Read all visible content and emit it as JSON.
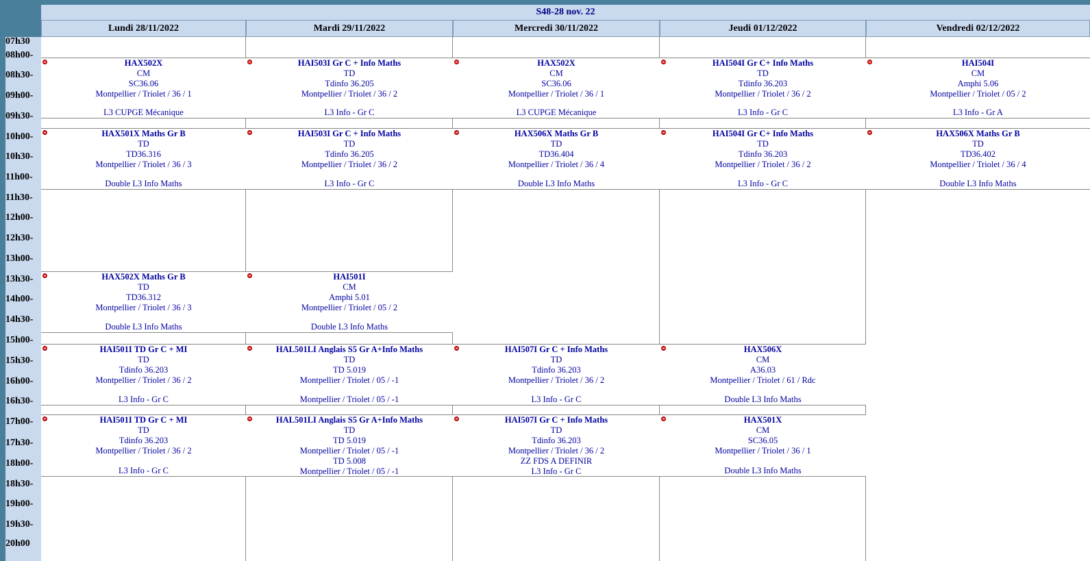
{
  "week_label": "S48-28 nov. 22",
  "days": [
    "Lundi 28/11/2022",
    "Mardi 29/11/2022",
    "Mercredi 30/11/2022",
    "Jeudi 01/12/2022",
    "Vendredi 02/12/2022"
  ],
  "times": [
    "07h30",
    "08h00-",
    "08h30-",
    "09h00-",
    "09h30-",
    "10h00-",
    "10h30-",
    "11h00-",
    "11h30-",
    "12h00-",
    "12h30-",
    "13h00-",
    "13h30-",
    "14h00-",
    "14h30-",
    "15h00-",
    "15h30-",
    "16h00-",
    "16h30-",
    "17h00-",
    "17h30-",
    "18h00-",
    "18h30-",
    "19h00-",
    "19h30-",
    "20h00"
  ],
  "events": {
    "mon_1": {
      "title": "HAX502X",
      "type": "CM",
      "room": "SC36.06",
      "place": "Montpellier / Triolet / 36 / 1",
      "group": "L3 CUPGE Mécanique"
    },
    "mon_2": {
      "title": "HAX501X Maths Gr B",
      "type": "TD",
      "room": "TD36.316",
      "place": "Montpellier / Triolet / 36 / 3",
      "group": "Double L3 Info Maths"
    },
    "mon_3": {
      "title": "HAX502X Maths Gr B",
      "type": "TD",
      "room": "TD36.312",
      "place": "Montpellier / Triolet / 36 / 3",
      "group": "Double L3 Info Maths"
    },
    "mon_4": {
      "title": "HAI501I TD Gr C + MI",
      "type": "TD",
      "room": "Tdinfo 36.203",
      "place": "Montpellier / Triolet / 36 / 2",
      "group": "L3 Info - Gr C"
    },
    "mon_5": {
      "title": "HAI501I TD Gr C + MI",
      "type": "TD",
      "room": "Tdinfo 36.203",
      "place": "Montpellier / Triolet / 36 / 2",
      "group": "L3 Info - Gr C"
    },
    "tue_1": {
      "title": "HAI503I Gr C + Info Maths",
      "type": "TD",
      "room": "Tdinfo 36.205",
      "place": "Montpellier / Triolet / 36 / 2",
      "group": "L3 Info - Gr C"
    },
    "tue_2": {
      "title": "HAI503I Gr C + Info Maths",
      "type": "TD",
      "room": "Tdinfo 36.205",
      "place": "Montpellier / Triolet / 36 / 2",
      "group": "L3 Info - Gr C"
    },
    "tue_3": {
      "title": "HAI501I",
      "type": "CM",
      "room": "Amphi 5.01",
      "place": "Montpellier / Triolet / 05 / 2",
      "group": "Double L3 Info Maths"
    },
    "tue_4": {
      "title": "HAL501LI Anglais S5 Gr A+Info Maths",
      "type": "TD",
      "room": "TD 5.019",
      "place": "Montpellier / Triolet / 05 / -1",
      "group": "Montpellier / Triolet / 05 / -1"
    },
    "tue_5": {
      "title": "HAL501LI Anglais S5 Gr A+Info Maths",
      "type": "TD",
      "room": "TD 5.019",
      "place": "Montpellier / Triolet / 05 / -1",
      "room2": "TD 5.008",
      "group": "Montpellier / Triolet / 05 / -1"
    },
    "wed_1": {
      "title": "HAX502X",
      "type": "CM",
      "room": "SC36.06",
      "place": "Montpellier / Triolet / 36 / 1",
      "group": "L3 CUPGE Mécanique"
    },
    "wed_2": {
      "title": "HAX506X Maths Gr B",
      "type": "TD",
      "room": "TD36.404",
      "place": "Montpellier / Triolet / 36 / 4",
      "group": "Double L3 Info Maths"
    },
    "wed_3": {
      "title": "HAI507I Gr C + Info Maths",
      "type": "TD",
      "room": "Tdinfo 36.203",
      "place": "Montpellier / Triolet / 36 / 2",
      "group": "L3 Info - Gr C"
    },
    "wed_4": {
      "title": "HAI507I Gr C + Info Maths",
      "type": "TD",
      "room": "Tdinfo 36.203",
      "place": "Montpellier / Triolet / 36 / 2",
      "extra": "ZZ FDS   A DEFINIR",
      "group": "L3 Info - Gr C"
    },
    "thu_1": {
      "title": "HAI504I Gr C+ Info Maths",
      "type": "TD",
      "room": "Tdinfo 36.203",
      "place": "Montpellier / Triolet / 36 / 2",
      "group": "L3 Info - Gr C"
    },
    "thu_2": {
      "title": "HAI504I Gr C+ Info Maths",
      "type": "TD",
      "room": "Tdinfo 36.203",
      "place": "Montpellier / Triolet / 36 / 2",
      "group": "L3 Info - Gr C"
    },
    "thu_3": {
      "title": "HAX506X",
      "type": "CM",
      "room": "A36.03",
      "place": "Montpellier / Triolet / 61 / Rdc",
      "group": "Double L3 Info Maths"
    },
    "thu_4": {
      "title": "HAX501X",
      "type": "CM",
      "room": "SC36.05",
      "place": "Montpellier / Triolet / 36 / 1",
      "group": "Double L3 Info Maths"
    },
    "fri_1": {
      "title": "HAI504I",
      "type": "CM",
      "room": "Amphi 5.06",
      "place": "Montpellier / Triolet / 05 / 2",
      "group": "L3 Info - Gr A"
    },
    "fri_2": {
      "title": "HAX506X Maths Gr B",
      "type": "TD",
      "room": "TD36.402",
      "place": "Montpellier / Triolet / 36 / 4",
      "group": "Double L3 Info Maths"
    }
  }
}
